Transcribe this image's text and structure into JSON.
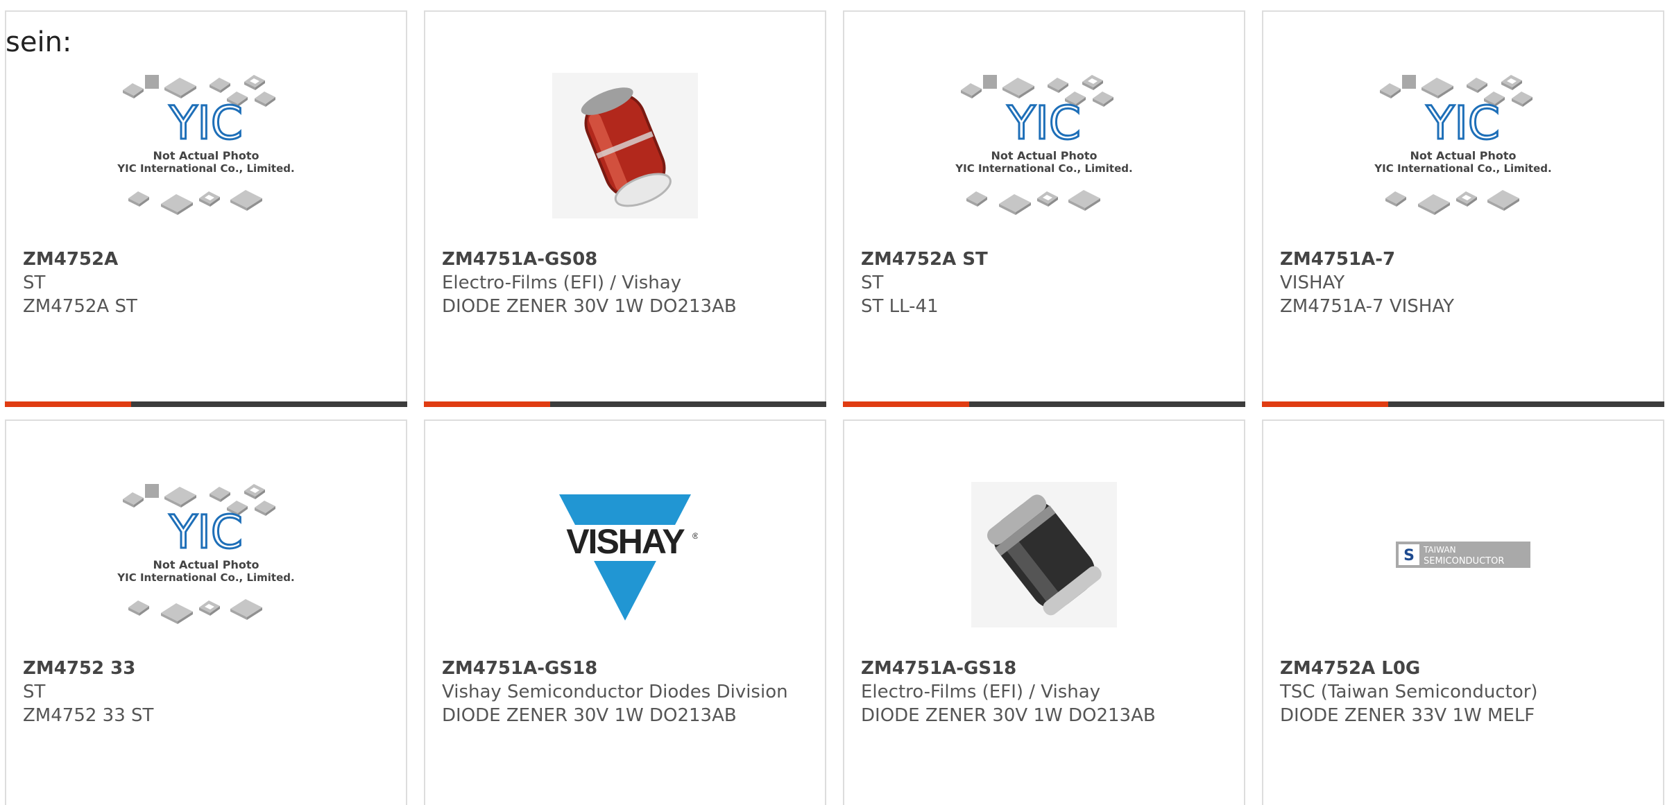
{
  "intro_text": "sein:",
  "colors": {
    "accent": "#e03c12",
    "bar": "#3c3c3c",
    "border": "#dddddd",
    "yic_blue": "#1e6fb8",
    "vishay_blue": "#2196d3"
  },
  "placeholder_image": {
    "line1": "Not Actual Photo",
    "line2": "YIC International Co., Limited.",
    "logo": "YIC"
  },
  "vishay_logo_text": "VISHAY",
  "taiwan_logo": {
    "line1": "TAIWAN",
    "line2": "SEMICONDUCTOR"
  },
  "products": [
    {
      "part_number": "ZM4752A",
      "manufacturer": "ST",
      "description": "ZM4752A ST",
      "image": "yic-placeholder"
    },
    {
      "part_number": "ZM4751A-GS08",
      "manufacturer": "Electro-Films (EFI) / Vishay",
      "description": "DIODE ZENER 30V 1W DO213AB",
      "image": "red-diode-photo"
    },
    {
      "part_number": "ZM4752A ST",
      "manufacturer": "ST",
      "description": "ST LL-41",
      "image": "yic-placeholder"
    },
    {
      "part_number": "ZM4751A-7",
      "manufacturer": "VISHAY",
      "description": "ZM4751A-7 VISHAY",
      "image": "yic-placeholder"
    },
    {
      "part_number": "ZM4752 33",
      "manufacturer": "ST",
      "description": "ZM4752 33 ST",
      "image": "yic-placeholder"
    },
    {
      "part_number": "ZM4751A-GS18",
      "manufacturer": "Vishay Semiconductor Diodes Division",
      "description": "DIODE ZENER 30V 1W DO213AB",
      "image": "vishay-logo"
    },
    {
      "part_number": "ZM4751A-GS18",
      "manufacturer": "Electro-Films (EFI) / Vishay",
      "description": "DIODE ZENER 30V 1W DO213AB",
      "image": "black-diode-photo"
    },
    {
      "part_number": "ZM4752A L0G",
      "manufacturer": "TSC (Taiwan Semiconductor)",
      "description": "DIODE ZENER 33V 1W MELF",
      "image": "taiwan-semiconductor-logo"
    }
  ]
}
